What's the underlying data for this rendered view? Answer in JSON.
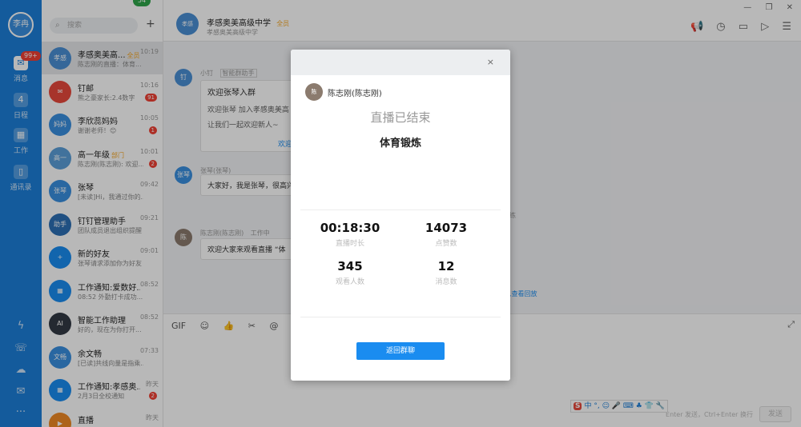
{
  "rail": {
    "user": "李冉",
    "badge": "99+",
    "nav": [
      {
        "label": "消息",
        "icon": "chat-bubble-icon"
      },
      {
        "label": "日程",
        "icon": "calendar-icon",
        "num": "4"
      },
      {
        "label": "工作",
        "icon": "apps-grid-icon"
      },
      {
        "label": "通讯录",
        "icon": "contacts-icon"
      }
    ],
    "bottom_icons": [
      "lightning-icon",
      "phone-icon",
      "cloud-icon",
      "mail-icon",
      "more-icon"
    ]
  },
  "conv_list": {
    "search_placeholder": "搜索",
    "green_badge": "54",
    "items": [
      {
        "name": "孝感奥美高...",
        "tag": "全员",
        "time": "10:19",
        "msg": "陈志刚的直播：体育...",
        "av": "孝感",
        "color": "#4a8fd4"
      },
      {
        "name": "钉邮",
        "tag": "",
        "time": "10:16",
        "msg": "熊之豪家长:2.4数字",
        "count": "91",
        "av": "✉",
        "color": "#e8483c"
      },
      {
        "name": "李欣蕊妈妈",
        "tag": "",
        "time": "10:05",
        "msg": "谢谢老师！😊",
        "count": "1",
        "av": "妈妈",
        "color": "#3a8fe0"
      },
      {
        "name": "高一年级",
        "tag": "部门",
        "time": "10:01",
        "msg": "陈志刚(陈志刚): 欢迎...",
        "count": "2",
        "av": "高一",
        "color": "#5a9fd8"
      },
      {
        "name": "张琴",
        "tag": "",
        "time": "09:42",
        "msg": "[未读]Hi，我通过你的...",
        "av": "张琴",
        "color": "#3a8fe0"
      },
      {
        "name": "钉钉管理助手",
        "tag": "",
        "time": "09:21",
        "msg": "团队成员退出组织提醒",
        "av": "助手",
        "color": "#2d6fb5"
      },
      {
        "name": "新的好友",
        "tag": "",
        "time": "09:01",
        "msg": "张琴请求添加你为好友",
        "av": "+",
        "color": "#1a8cf0"
      },
      {
        "name": "工作通知:爱数好...",
        "tag": "",
        "time": "08:52",
        "msg": "08:52 外勤打卡成功...",
        "av": "▦",
        "color": "#1a8cf0"
      },
      {
        "name": "智能工作助理",
        "tag": "",
        "time": "08:52",
        "msg": "好的，现在为你打开...",
        "av": "AI",
        "color": "#333a45"
      },
      {
        "name": "余文畅",
        "tag": "",
        "time": "07:33",
        "msg": "[已读]共线向量是指乘...",
        "av": "文畅",
        "color": "#3a8fe0"
      },
      {
        "name": "工作通知:孝感奥...",
        "tag": "",
        "time": "昨天",
        "msg": "2月3日全校通知",
        "count": "2",
        "av": "▦",
        "color": "#1a8cf0"
      },
      {
        "name": "直播",
        "tag": "",
        "time": "昨天",
        "msg": "",
        "av": "▶",
        "color": "#f08a24"
      }
    ]
  },
  "chat": {
    "group_name": "孝感奥美高级中学",
    "group_tag": "全员",
    "group_sub": "孝感奥美高级中学",
    "group_av": "孝感",
    "messages": {
      "m1_sender": "小钉",
      "m1_tag": "智能群助手",
      "m1_title": "欢迎张琴入群",
      "m1_body1": "欢迎张琴 加入孝感奥美高",
      "m1_body2": "让我们一起欢迎新人~",
      "m1_link": "欢迎",
      "m2_sender": "张琴(张琴)",
      "m2_body": "大家好，我是张琴，很高兴",
      "m3_sender": "陈志刚(陈志刚)",
      "m3_status": "工作中",
      "m3_body": "欢迎大家来观看直播 “体",
      "side_fragment": "练",
      "side_link": ",查看回放"
    },
    "hint": "Enter 发送，Ctrl+Enter 换行",
    "send": "发送",
    "ime": "中 °, ☺ 🎤 ⌨ ♣ 👕 🔧"
  },
  "modal": {
    "host": "陈志刚(陈志刚)",
    "status": "直播已结束",
    "title": "体育锻炼",
    "stats": [
      {
        "value": "00:18:30",
        "label": "直播时长"
      },
      {
        "value": "14073",
        "label": "点赞数"
      },
      {
        "value": "345",
        "label": "观看人数"
      },
      {
        "value": "12",
        "label": "消息数"
      }
    ],
    "back_button": "返回群聊",
    "close": "×"
  }
}
